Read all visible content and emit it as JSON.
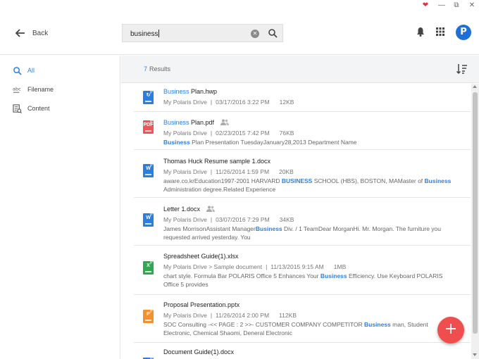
{
  "header": {
    "back_label": "Back",
    "search_value": "business"
  },
  "sidebar": {
    "items": [
      {
        "label": "All",
        "icon": "search-icon",
        "active": true
      },
      {
        "label": "Filename",
        "icon": "abc-icon",
        "active": false
      },
      {
        "label": "Content",
        "icon": "content-icon",
        "active": false
      }
    ]
  },
  "results": {
    "count": "7",
    "label": "Results"
  },
  "files": [
    {
      "type": "hwp",
      "name_hl": "Business",
      "name_rest": " Plan.hwp",
      "location": "My Polaris Drive",
      "date": "03/17/2016 3:22 PM",
      "size": "12KB"
    },
    {
      "type": "pdf",
      "name_hl": "Business",
      "name_rest": " Plan.pdf",
      "location": "My Polaris Drive",
      "date": "02/23/2015 7:42 PM",
      "size": "76KB",
      "snippet_hl": "Business",
      "snippet_rest": " Plan Presentation TuesdayJanuary28,2013 Department Name"
    },
    {
      "type": "docx",
      "name": "Thomas Huck Resume sample 1.docx",
      "location": "My Polaris Drive",
      "date": "11/26/2014 1:59 PM",
      "size": "20KB",
      "snippet_a": "aware.co.krEducation1997-2001 HARVARD ",
      "snippet_hl1": "BUSINESS",
      "snippet_b": " SCHOOL (HBS), BOSTON, MAMaster of ",
      "snippet_hl2": "Business",
      "snippet_c": " Administration degree.Related Experience"
    },
    {
      "type": "docx",
      "name": "Letter 1.docx",
      "location": "My Polaris Drive",
      "date": "03/07/2016 7:29 PM",
      "size": "34KB",
      "snippet_a": "James MorrisonAssistant Manager",
      "snippet_hl1": "Business",
      "snippet_b": " Div. / 1 TeamDear MorganHi. Mr. Morgan. The furniture you requested arrived yesterday.  You"
    },
    {
      "type": "xlsx",
      "name": "Spreadsheet Guide(1).xlsx",
      "location": "My Polaris Drive > Sample document",
      "date": "11/13/2015 9:15 AM",
      "size": "1MB",
      "snippet_a": "chart style. Formula Bar POLARIS Office 5 Enhances Your ",
      "snippet_hl1": "Business",
      "snippet_b": " Efficiency. Use Keyboard POLARIS Office 5 provides"
    },
    {
      "type": "pptx",
      "name": "Proposal Presentation.pptx",
      "location": "My Polaris Drive",
      "date": "11/26/2014 2:00 PM",
      "size": "112KB",
      "snippet_a": "SOC Consulting -<< PAGE : 2 >>- CUSTOMER COMPANY COMPETITOR ",
      "snippet_hl1": "Business",
      "snippet_b": " man, Student Electronic, Chemical Shaomi, Deneral Electronic"
    },
    {
      "type": "docx",
      "name": "Document Guide(1).docx"
    }
  ],
  "colors": {
    "accent": "#2f80de",
    "fab": "#f04e4e",
    "pdf": "#f05454",
    "xlsx": "#2fa84f",
    "pptx": "#f3912f"
  }
}
